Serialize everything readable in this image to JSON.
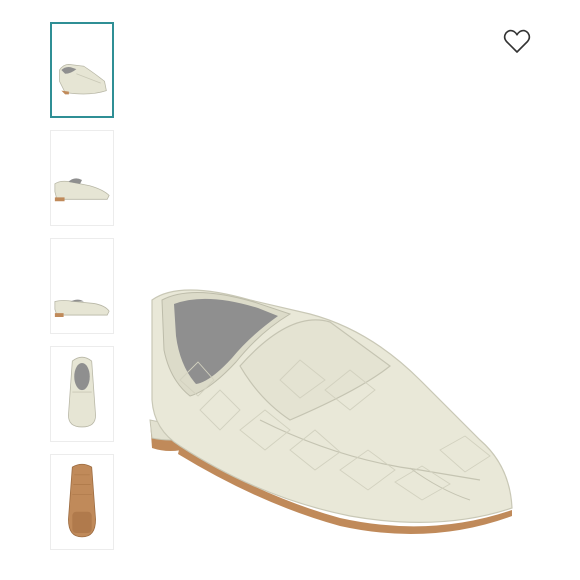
{
  "gallery": {
    "selected_index": 0,
    "thumbnails": [
      {
        "view": "three-quarter"
      },
      {
        "view": "side"
      },
      {
        "view": "side-low"
      },
      {
        "view": "top"
      },
      {
        "view": "sole"
      }
    ]
  },
  "actions": {
    "favorite_icon": "heart-outline-icon"
  },
  "product": {
    "color_leather": "#e9e8d8",
    "color_sole": "#c08a5a",
    "color_lining": "#8f8f8f"
  }
}
